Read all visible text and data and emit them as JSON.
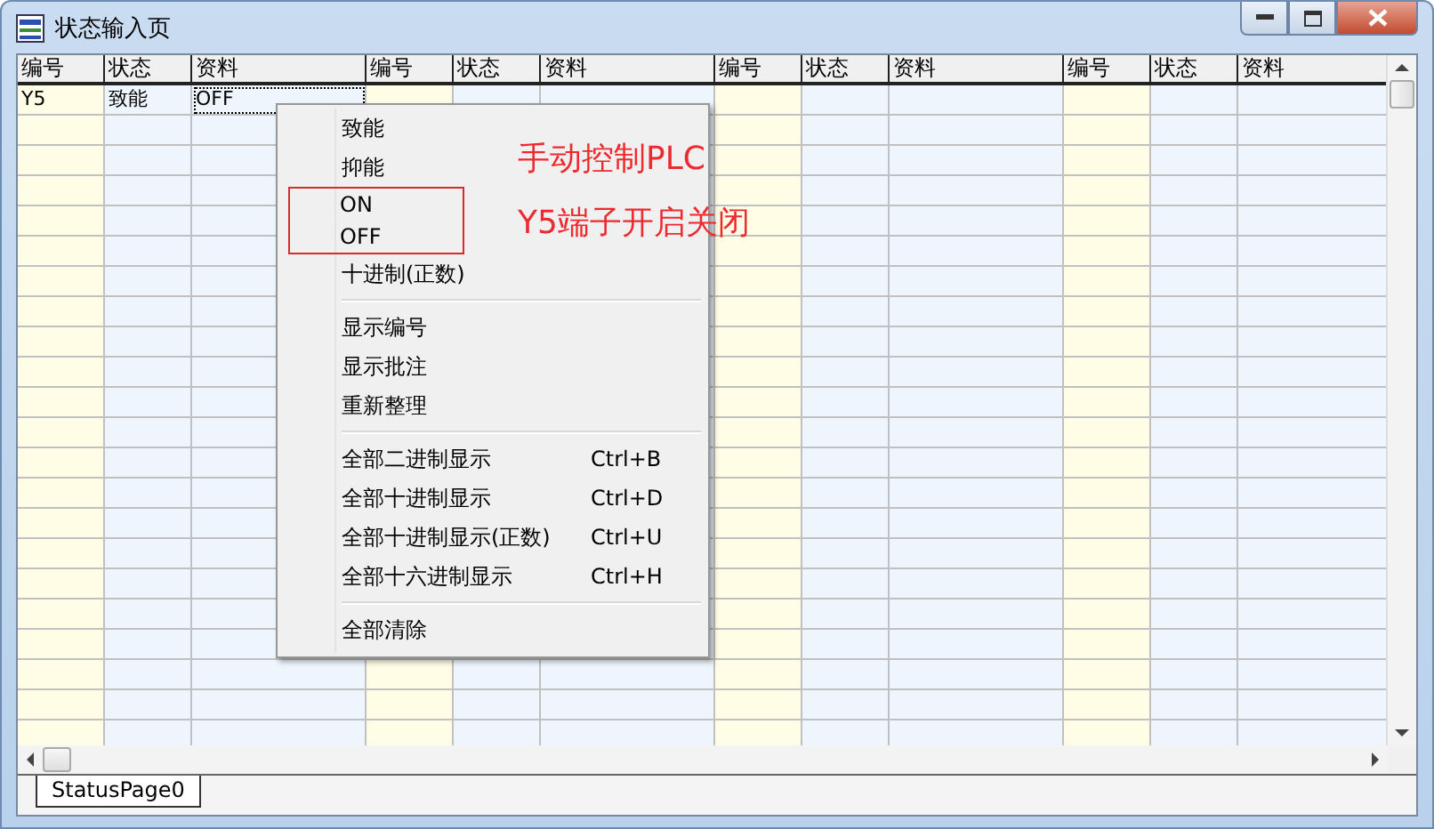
{
  "window": {
    "title": "状态输入页"
  },
  "table": {
    "columns": [
      "编号",
      "状态",
      "资料",
      "编号",
      "状态",
      "资料",
      "编号",
      "状态",
      "资料",
      "编号",
      "状态",
      "资料"
    ],
    "rows": [
      {
        "cells": [
          {
            "text": "Y5",
            "focused": false
          },
          {
            "text": "致能",
            "focused": false
          },
          {
            "text": "OFF",
            "focused": true
          }
        ]
      }
    ]
  },
  "context_menu": {
    "items": [
      {
        "kind": "item",
        "label": "致能"
      },
      {
        "kind": "item",
        "label": "抑能"
      },
      {
        "kind": "item",
        "label": "ON",
        "highlighted": true
      },
      {
        "kind": "item",
        "label": "OFF",
        "highlighted": true
      },
      {
        "kind": "item",
        "label": "十进制(正数)"
      },
      {
        "kind": "separator"
      },
      {
        "kind": "item",
        "label": "显示编号"
      },
      {
        "kind": "item",
        "label": "显示批注"
      },
      {
        "kind": "item",
        "label": "重新整理"
      },
      {
        "kind": "separator"
      },
      {
        "kind": "item",
        "label": "全部二进制显示",
        "shortcut": "Ctrl+B"
      },
      {
        "kind": "item",
        "label": "全部十进制显示",
        "shortcut": "Ctrl+D"
      },
      {
        "kind": "item",
        "label": "全部十进制显示(正数)",
        "shortcut": "Ctrl+U"
      },
      {
        "kind": "item",
        "label": "全部十六进制显示",
        "shortcut": "Ctrl+H"
      },
      {
        "kind": "separator"
      },
      {
        "kind": "item",
        "label": "全部清除"
      }
    ]
  },
  "annotation": {
    "lines": [
      "手动控制PLC",
      "Y5端子开启关闭"
    ]
  },
  "sheet_tabs": [
    {
      "label": "StatusPage0",
      "selected": true
    }
  ]
}
